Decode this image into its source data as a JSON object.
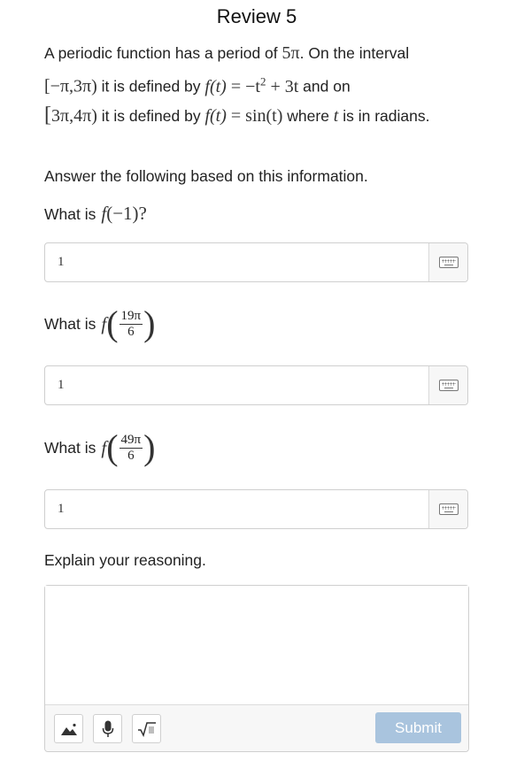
{
  "header": {
    "title": "Review 5"
  },
  "problem": {
    "p1": "A periodic function has a period of ",
    "period": "5π",
    "p2": ". On the interval",
    "interval1": "[−π,3π)",
    "p3": " it is defined by ",
    "f_of_t": "f(t)",
    "eq1_rhs_a": "= −t",
    "eq1_sup": "2",
    "eq1_rhs_b": " + 3t",
    "p4": " and on",
    "interval2_open": "[",
    "interval2": "3π,4π)",
    "p5": " it is defined by ",
    "eq2": "= sin(t)",
    "p6": " where ",
    "t_var": "t",
    "p7": " is in radians."
  },
  "intro": "Answer the following based on this information.",
  "questions": [
    {
      "label": "What is",
      "fname": "f",
      "expr": "(−1)?",
      "answer": "1"
    },
    {
      "label": "What is",
      "fname": "f",
      "num": "19π",
      "den": "6",
      "answer": "1"
    },
    {
      "label": "What is",
      "fname": "f",
      "num": "49π",
      "den": "6",
      "answer": "1"
    }
  ],
  "explain": {
    "label": "Explain your reasoning.",
    "value": ""
  },
  "toolbar": {
    "icons": [
      "image-icon",
      "microphone-icon",
      "square-root-icon"
    ],
    "submit_label": "Submit"
  },
  "colors": {
    "submit_bg": "#a9c4de",
    "border": "#cfcfcf"
  }
}
